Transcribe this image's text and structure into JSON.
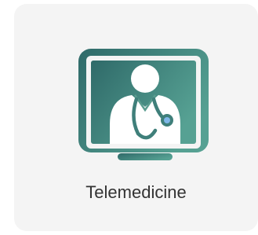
{
  "card": {
    "label": "Telemedicine",
    "icon": "telemedicine-monitor-doctor-icon"
  },
  "colors": {
    "card_bg": "#f4f4f4",
    "gradient_start": "#2f6a69",
    "gradient_end": "#56a193",
    "figure": "#ffffff",
    "text": "#333333"
  }
}
